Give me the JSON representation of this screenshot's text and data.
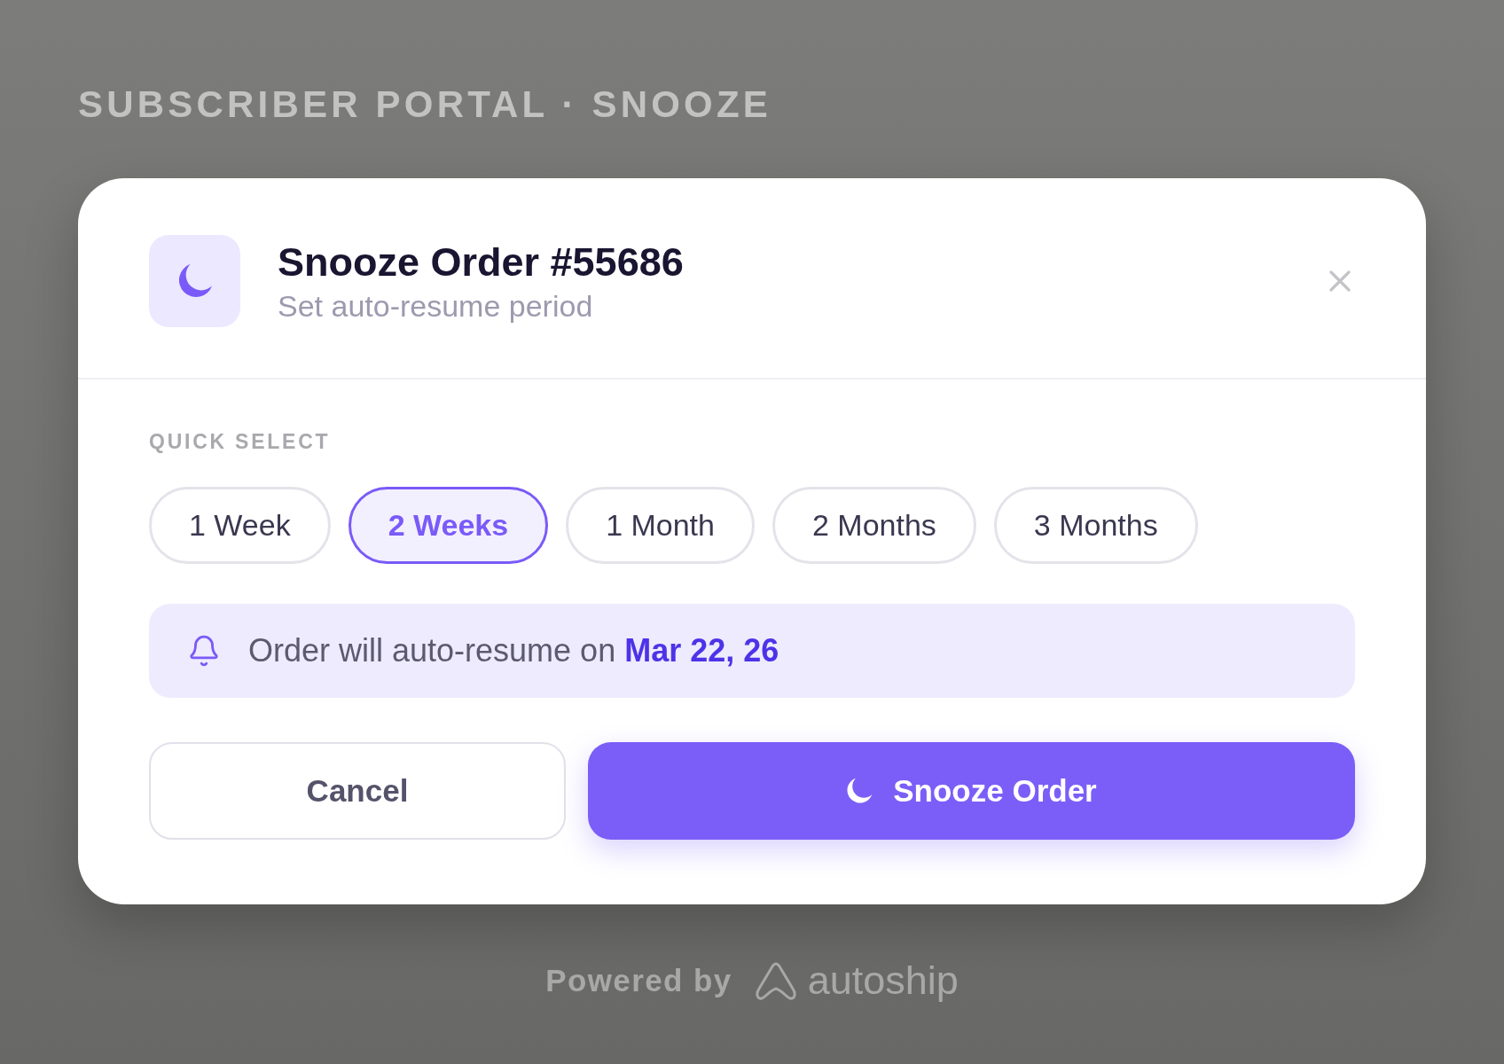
{
  "page": {
    "title": "SUBSCRIBER PORTAL · SNOOZE"
  },
  "dialog": {
    "title": "Snooze Order #55686",
    "subtitle": "Set auto-resume period",
    "quick_select": {
      "label": "QUICK SELECT",
      "options": [
        {
          "label": "1 Week",
          "selected": false
        },
        {
          "label": "2 Weeks",
          "selected": true
        },
        {
          "label": "1 Month",
          "selected": false
        },
        {
          "label": "2 Months",
          "selected": false
        },
        {
          "label": "3 Months",
          "selected": false
        }
      ]
    },
    "notice": {
      "text": "Order will auto-resume on",
      "date": "Mar 22, 26"
    },
    "actions": [
      {
        "kind": "secondary",
        "label": "Cancel"
      },
      {
        "kind": "primary",
        "label": "Snooze Order"
      }
    ]
  },
  "footer": {
    "text": "Powered by",
    "brand": "autoship"
  }
}
